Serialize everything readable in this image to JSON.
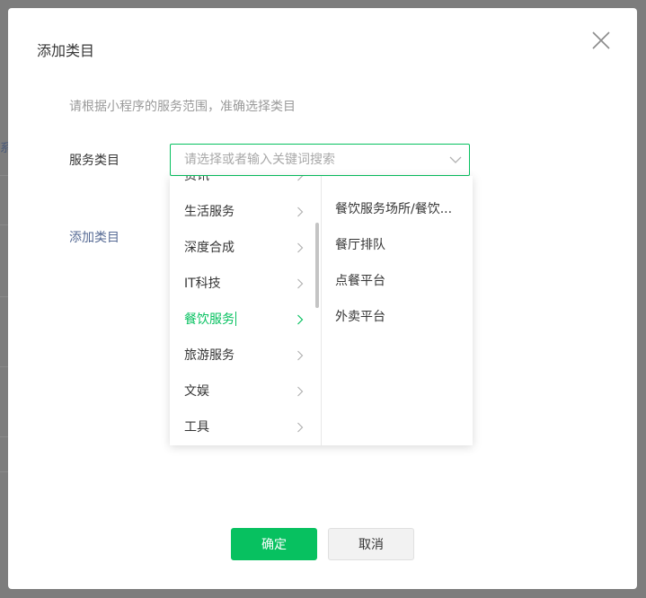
{
  "dialog": {
    "title": "添加类目",
    "tip": "请根据小程序的服务范围，准确选择类目",
    "field_label": "服务类目",
    "select": {
      "placeholder": "请选择或者输入关键词搜索",
      "value": ""
    },
    "add_link": "添加类目",
    "confirm_label": "确定",
    "cancel_label": "取消"
  },
  "dropdown": {
    "level1": [
      {
        "label": "资讯"
      },
      {
        "label": "生活服务"
      },
      {
        "label": "深度合成"
      },
      {
        "label": "IT科技"
      },
      {
        "label": "餐饮服务",
        "active": true
      },
      {
        "label": "旅游服务"
      },
      {
        "label": "文娱"
      },
      {
        "label": "工具"
      }
    ],
    "level2": [
      {
        "label": "餐饮服务场所/餐饮..."
      },
      {
        "label": "餐厅排队"
      },
      {
        "label": "点餐平台"
      },
      {
        "label": "外卖平台"
      }
    ]
  },
  "background": {
    "edge_char": "系"
  },
  "colors": {
    "accent": "#07c160",
    "link": "#576b95",
    "overlay": "#7d7d7d"
  },
  "icons": {
    "close": "close-icon",
    "select_arrow": "chevron-down-icon",
    "item_arrow": "chevron-right-icon"
  }
}
